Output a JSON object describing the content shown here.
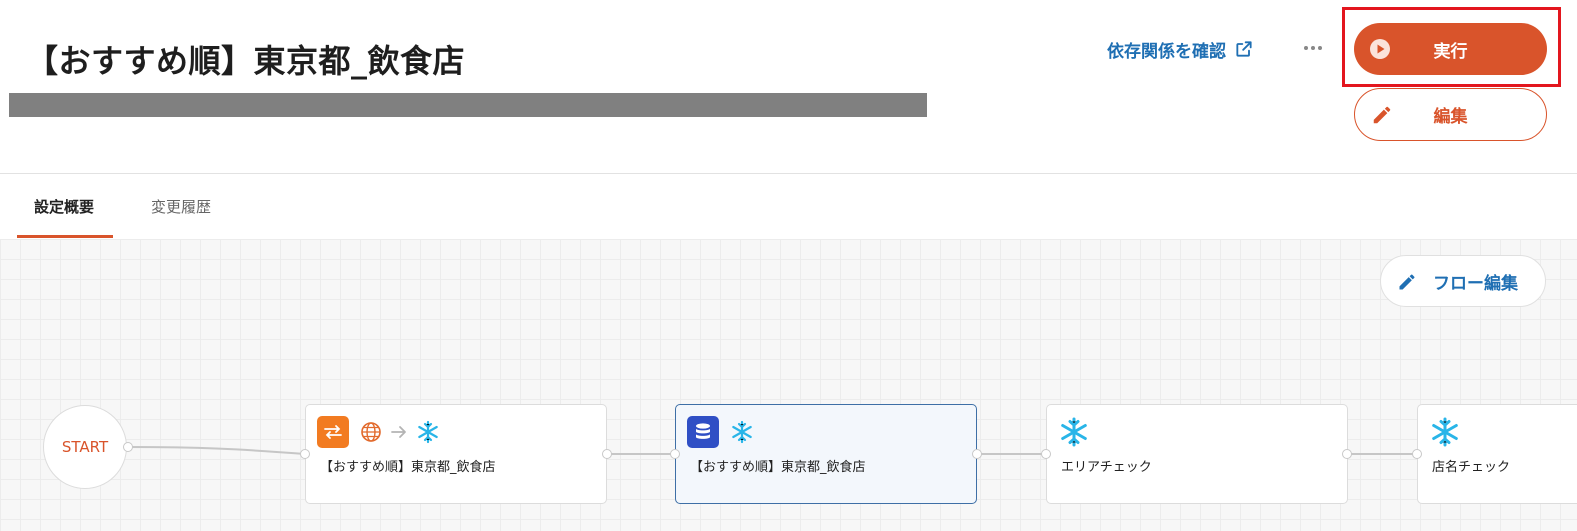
{
  "header": {
    "title": "【おすすめ順】東京都_飲食店",
    "dependency_link": "依存関係を確認",
    "run_label": "実行",
    "edit_label": "編集"
  },
  "tabs": [
    {
      "label": "設定概要",
      "active": true
    },
    {
      "label": "変更履歴",
      "active": false
    }
  ],
  "flow": {
    "edit_button": "フロー編集",
    "start_label": "START",
    "nodes": [
      {
        "label": "【おすすめ順】東京都_飲食店",
        "icons": [
          "transfer-icon",
          "globe-icon",
          "arrow-right-icon",
          "snowflake-icon"
        ]
      },
      {
        "label": "【おすすめ順】東京都_飲食店",
        "icons": [
          "database-icon",
          "snowflake-icon"
        ],
        "selected": true
      },
      {
        "label": "エリアチェック",
        "icons": [
          "snowflake-icon"
        ]
      },
      {
        "label": "店名チェック",
        "icons": [
          "snowflake-icon"
        ]
      }
    ]
  },
  "colors": {
    "accent": "#d9542b",
    "link": "#1f6fb3",
    "highlight": "#e3161e",
    "snowflake": "#29b5e8"
  }
}
